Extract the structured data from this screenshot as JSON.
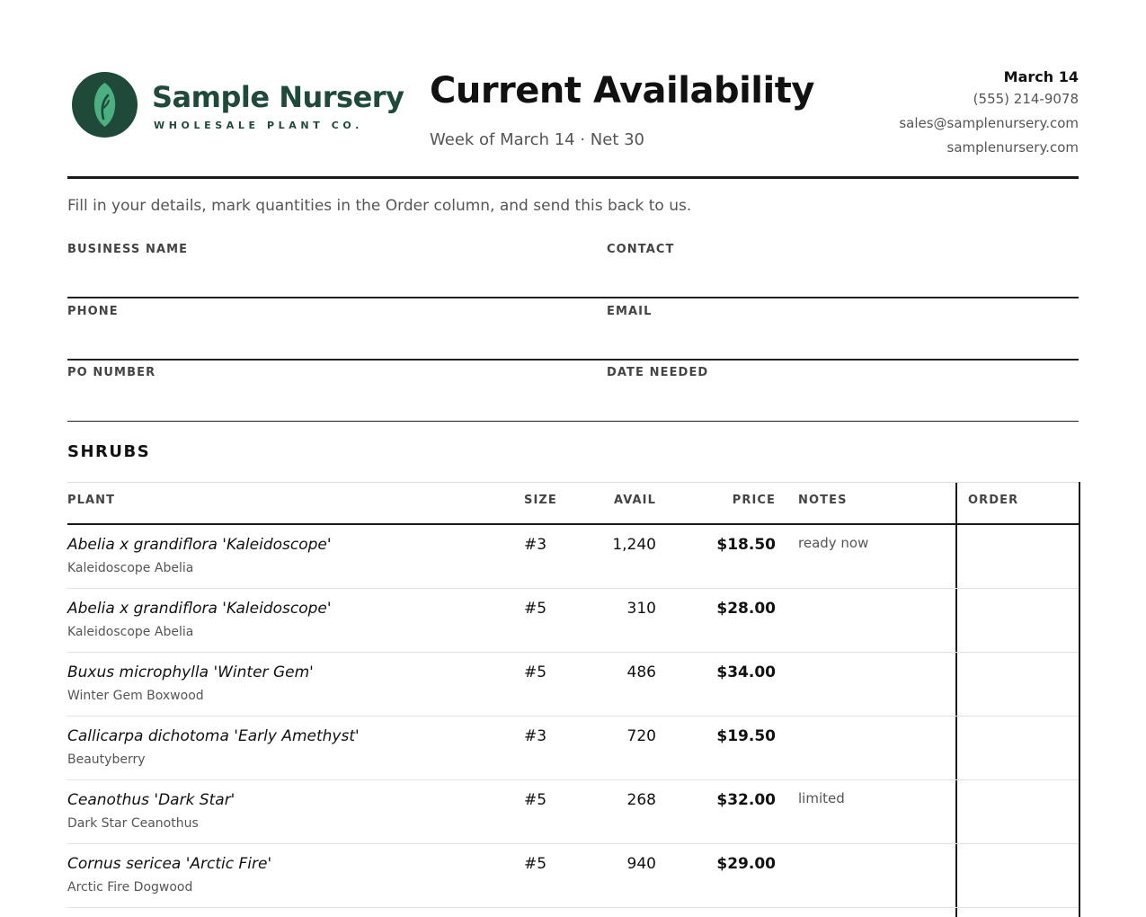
{
  "brand": {
    "name": "Sample Nursery",
    "tagline": "WHOLESALE PLANT CO.",
    "logo_icon": "leaf-icon",
    "color": "#1f4a39",
    "accent": "#4caf82"
  },
  "header": {
    "title": "Current Availability",
    "subtitle": "Week of March 14 · Net 30",
    "date": "March 14",
    "phone": "(555) 214-9078",
    "email": "sales@samplenursery.com",
    "website": "samplenursery.com"
  },
  "form": {
    "instructions": "Fill in your details, mark quantities in the Order column, and send this back to us.",
    "fields": {
      "business_name": "BUSINESS NAME",
      "contact": "CONTACT",
      "phone": "PHONE",
      "email": "EMAIL",
      "po_number": "PO NUMBER",
      "date_needed": "DATE NEEDED"
    }
  },
  "section": {
    "title": "SHRUBS",
    "columns": {
      "plant": "PLANT",
      "size": "SIZE",
      "avail": "AVAIL",
      "price": "PRICE",
      "notes": "NOTES",
      "order": "ORDER"
    },
    "rows": [
      {
        "botanical": "Abelia x grandiflora 'Kaleidoscope'",
        "common": "Kaleidoscope Abelia",
        "size": "#3",
        "avail": "1,240",
        "price": "$18.50",
        "notes": "ready now"
      },
      {
        "botanical": "Abelia x grandiflora 'Kaleidoscope'",
        "common": "Kaleidoscope Abelia",
        "size": "#5",
        "avail": "310",
        "price": "$28.00",
        "notes": ""
      },
      {
        "botanical": "Buxus microphylla 'Winter Gem'",
        "common": "Winter Gem Boxwood",
        "size": "#5",
        "avail": "486",
        "price": "$34.00",
        "notes": ""
      },
      {
        "botanical": "Callicarpa dichotoma 'Early Amethyst'",
        "common": "Beautyberry",
        "size": "#3",
        "avail": "720",
        "price": "$19.50",
        "notes": ""
      },
      {
        "botanical": "Ceanothus 'Dark Star'",
        "common": "Dark Star Ceanothus",
        "size": "#5",
        "avail": "268",
        "price": "$32.00",
        "notes": "limited"
      },
      {
        "botanical": "Cornus sericea 'Arctic Fire'",
        "common": "Arctic Fire Dogwood",
        "size": "#5",
        "avail": "940",
        "price": "$29.00",
        "notes": ""
      }
    ]
  }
}
